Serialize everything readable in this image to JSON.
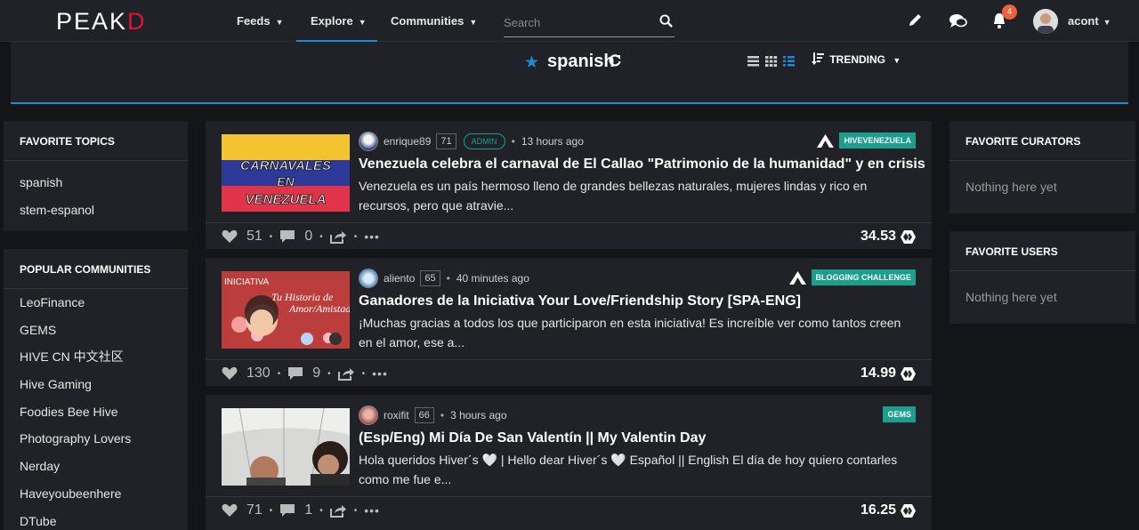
{
  "brand": {
    "logo_prefix": "PEAK",
    "logo_suffix": "D"
  },
  "nav": [
    {
      "label": "Feeds"
    },
    {
      "label": "Explore"
    },
    {
      "label": "Communities"
    }
  ],
  "search": {
    "placeholder": "Search"
  },
  "notifications": {
    "count": "4"
  },
  "user": {
    "name": "acont"
  },
  "header": {
    "tag": "spanish",
    "sort_label": "TRENDING"
  },
  "left": {
    "topics_title": "FAVORITE TOPICS",
    "topics": [
      "spanish",
      "stem-espanol"
    ],
    "communities_title": "POPULAR COMMUNITIES",
    "communities": [
      "LeoFinance",
      "GEMS",
      "HIVE CN 中文社区",
      "Hive Gaming",
      "Foodies Bee Hive",
      "Photography Lovers",
      "Nerday",
      "Haveyoubeenhere",
      "DTube"
    ]
  },
  "right": {
    "curators_title": "FAVORITE CURATORS",
    "curators_empty": "Nothing here yet",
    "users_title": "FAVORITE USERS",
    "users_empty": "Nothing here yet"
  },
  "posts": [
    {
      "author": "enrique89",
      "rep": "71",
      "role": "ADMIN",
      "time": "13 hours ago",
      "community": "HIVEVENEZUELA",
      "title": "Venezuela celebra el carnaval de El Callao \"Patrimonio de la humanidad\" y en crisis",
      "body": "Venezuela es un país hermoso lleno de grandes bellezas naturales, mujeres lindas y rico en recursos, pero que atravie...",
      "votes": "51",
      "comments": "0",
      "payout": "34.53",
      "thumb_line1": "CARNAVALES",
      "thumb_line2": "EN",
      "thumb_line3": "VENEZUELA"
    },
    {
      "author": "aliento",
      "rep": "65",
      "role": "",
      "time": "40 minutes ago",
      "community": "BLOGGING CHALLENGE",
      "title": "Ganadores de la Iniciativa Your Love/Friendship Story [SPA-ENG]",
      "body": "¡Muchas gracias a todos los que participaron en esta iniciativa! Es increíble ver como tantos creen en el amor, ese a...",
      "votes": "130",
      "comments": "9",
      "payout": "14.99",
      "thumb_line1": "INICIATIVA",
      "thumb_line2": "Tu Historia de",
      "thumb_line3": "Amor/Amistad"
    },
    {
      "author": "roxifit",
      "rep": "66",
      "role": "",
      "time": "3 hours ago",
      "community": "GEMS",
      "title": "(Esp/Eng) Mi Día De San Valentín || My Valentin Day",
      "body": "Hola queridos Hiver´s 🤍 | Hello dear Hiver´s 🤍 Español || English El día de hoy quiero contarles como me fue e...",
      "votes": "71",
      "comments": "1",
      "payout": "16.25"
    }
  ],
  "colors": {
    "accent": "#1a8cd8",
    "community": "#1a9e8e",
    "brand_red": "#e31337",
    "badge": "#f0603a"
  }
}
